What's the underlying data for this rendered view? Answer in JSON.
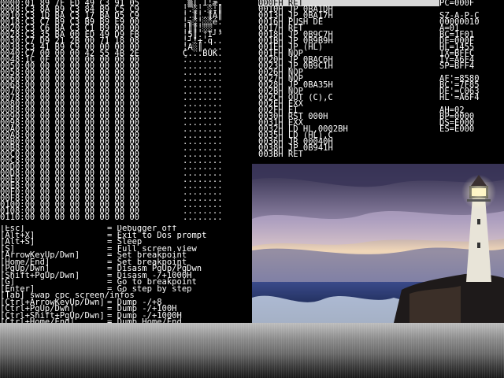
{
  "memory_dump": [
    "0000:01 89 7F ED 49 C3 91 05",
    "0008:C3 8A B9 C3 84 B9 C5 C9",
    "0010:C3 1D BA C3 17 BA D5 C9",
    "0018:C3 C7 B9 C3 B9 B9 E9 00",
    "0020:C3 C6 BA C3 C1 B9 00 00",
    "0028:C3 35 BA 00 ED 49 D9 FB",
    "0030:C7 D9 21 2B 00 71 18 08",
    "0038:C3 41 B9 C9 00 00 00 00",
    "0040:C7 00 00 00 42 55 4B 2E",
    "0048:1C 0F 00 00 00 00 00 00",
    "0050:00 00 00 00 00 00 00 00",
    "0058:00 00 00 00 00 00 00 00",
    "0060:00 00 00 00 00 00 00 00",
    "0068:00 00 00 00 00 00 00 00",
    "0070:00 00 00 00 00 00 00 00",
    "0078:00 00 00 00 00 00 00 00",
    "0080:00 00 00 00 00 00 00 00",
    "0088:00 00 00 00 00 00 00 00",
    "0090:00 00 00 00 00 00 00 00",
    "0098:00 00 00 00 00 00 00 00",
    "00A0:00 00 00 00 00 00 00 00",
    "00A8:00 00 00 00 00 00 00 00",
    "00B0:00 00 00 00 00 00 00 00",
    "00B8:00 00 00 00 00 00 00 00",
    "00C0:00 00 00 00 00 00 00 00",
    "00C8:00 00 00 00 00 00 00 00",
    "00D0:00 00 00 00 00 00 00 00",
    "00D8:00 00 00 00 00 00 00 00",
    "00E0:00 00 00 00 00 00 00 00",
    "00E8:00 00 00 00 00 00 00 00",
    "00F0:00 00 00 00 00 00 00 00",
    "00F8:00 00 00 00 00 00 00 00",
    "0100:00 00 00 00 00 00 00 00",
    "0108:00 00 00 00 00 00 00 00",
    "0110:00 00 00 00 00 00 00 00"
  ],
  "ascii_dump": [
    ".▒⌠.I¦æ.",
    "¦.░¦.░¦║",
    "¦.║¦.║Ä║",
    "¦╗░¦░░é.",
    "¦║║¦░░..",
    "¦5║.¦I┘³",
    "¦┘!+.q..",
    "¦A░║....",
    "Ç...BUK.",
    "........",
    "........",
    "........",
    "........",
    "........",
    "........",
    "........",
    "........",
    "........",
    "........",
    "........",
    "........",
    "........",
    "........",
    "........",
    "........",
    "........",
    "........",
    "........",
    "........",
    "........",
    "........",
    "........",
    "........",
    "........",
    "........"
  ],
  "disassembly": [
    "000FH RET",
    "0010H JP 0BA1DH",
    "0013H JP 0BA17H",
    "0016H PUSH DE",
    "0017H RET",
    "0018H JP 0B9C7H",
    "001BH JP 0B9B9H",
    "001EH JP (HL)",
    "001FH NOP",
    "0020H JP 0BAC6H",
    "0023H JP 0B9C1H",
    "0026H NOP",
    "0027H NOP",
    "0028H JP 0BA35H",
    "002BH NOP",
    "002CH OUT (C),C",
    "002EH EXX",
    "002FH EI",
    "0030H RST 000H",
    "0031H EXX",
    "0032H LD HL,0002BH",
    "0035H LD (HL),C",
    "0036H JR 00040H",
    "0038H JP 0B941H",
    "003BH RET"
  ],
  "registers": [
    "PC=000F",
    "",
    "SZ-A-P-C",
    "00000010",
    "A=01",
    "BC=1F01",
    "DE=000F",
    "HL=1455",
    "IX=BFFC",
    "IY=A6F4",
    "SP=BFF4",
    "",
    "AF'=8580",
    "BC'=7F85",
    "DE'=C063",
    "HL'=A6F4",
    "",
    "AH=02",
    "BP=0000",
    "DS=E000",
    "ES=E000"
  ],
  "help": [
    {
      "key": "[Esc]",
      "desc": "= Debugger off"
    },
    {
      "key": "[Alt+X]",
      "desc": "= Exit to Dos prompt"
    },
    {
      "key": "[Alt+S]",
      "desc": "= Sleep"
    },
    {
      "key": "[S]",
      "desc": "= Full screen view"
    },
    {
      "key": "[ArrowKeyUp/Dwn]",
      "desc": "= Set breakpoint"
    },
    {
      "key": "[Home/End]",
      "desc": "= Set breakpoint"
    },
    {
      "key": "[PgUp/Dwn]",
      "desc": "= Disasm PgUp/PgDwn"
    },
    {
      "key": "[Shift+PgUp/Dwn]",
      "desc": "= Disasm -/+1000H"
    },
    {
      "key": "[G]",
      "desc": "= Go to breakpoint"
    },
    {
      "key": "[Enter]",
      "desc": "= Go step by step"
    },
    {
      "key": "[Tab] swap cpc screen/infos",
      "desc": ""
    },
    {
      "key": "[Ctrl+ArrowKeyUp/Dwn]",
      "desc": "= Dump -/+8"
    },
    {
      "key": "[Ctrl+PgUp/Dwn]",
      "desc": "= Dump -/+100H"
    },
    {
      "key": "[Ctrl+Shift+PgUp/Dwn]",
      "desc": "= Dump -/+1000H"
    },
    {
      "key": "[Ctrl+Home/End]",
      "desc": "= Dump Home/End"
    }
  ],
  "colors": {
    "background": "#000000",
    "text": "#ffffff",
    "selection": "#d8d8d8"
  }
}
